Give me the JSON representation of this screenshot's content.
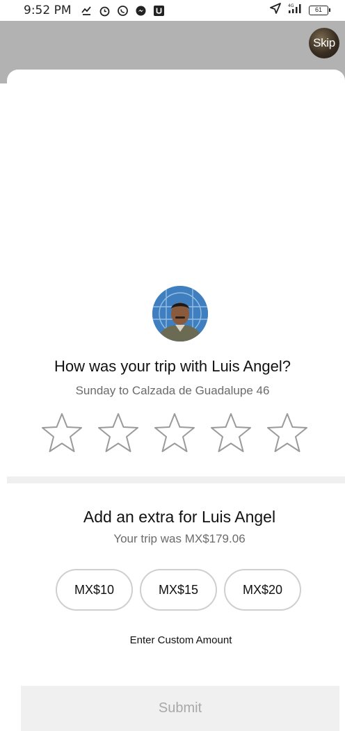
{
  "status_bar": {
    "time": "9:52 PM",
    "network": "4G",
    "battery": "61",
    "icons": [
      "missed-call-icon",
      "alarm-icon",
      "whatsapp-icon",
      "messenger-icon",
      "u-app-icon",
      "location-arrow-icon",
      "signal-icon",
      "battery-icon"
    ]
  },
  "header": {
    "skip_label": "Skip"
  },
  "rating": {
    "question": "How was your trip with Luis Angel?",
    "detail": "Sunday to Calzada de Guadalupe 46",
    "stars_total": 5,
    "stars_selected": 0
  },
  "tip": {
    "title": "Add an extra for Luis Angel",
    "subtitle": "Your trip was MX$179.06",
    "options": [
      "MX$10",
      "MX$15",
      "MX$20"
    ],
    "custom_label": "Enter Custom Amount"
  },
  "submit": {
    "label": "Submit"
  },
  "colors": {
    "backdrop": "#b2b2b2",
    "star_outline": "#9a9a9a",
    "chip_border": "#cfcfcf",
    "submit_bg": "#f0f0f0",
    "submit_text": "#a8a8a8"
  }
}
